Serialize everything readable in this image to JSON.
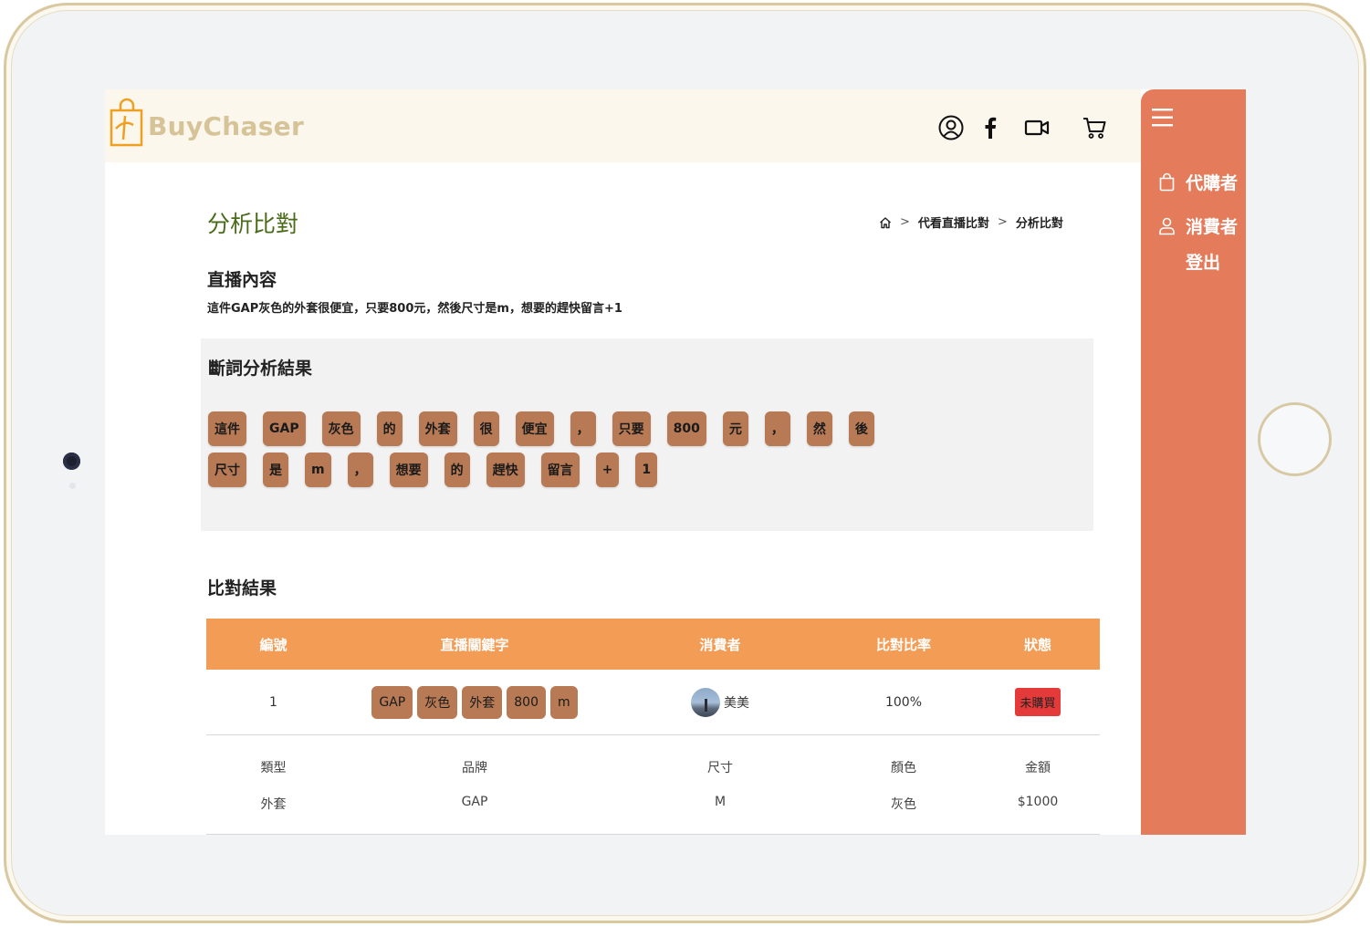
{
  "brand": {
    "name": "BuyChaser",
    "color": "#d6c398"
  },
  "header_icons": [
    "user-circle-icon",
    "facebook-icon",
    "video-icon",
    "cart-icon"
  ],
  "sidebar": {
    "menu_icon": "hamburger-icon",
    "items": [
      {
        "label": "代購者",
        "icon": "bag-icon"
      },
      {
        "label": "消費者",
        "icon": "user-icon"
      },
      {
        "label": "登出"
      }
    ]
  },
  "page": {
    "title": "分析比對"
  },
  "breadcrumb": {
    "home_icon": "home-icon",
    "sep": ">",
    "level1": "代看直播比對",
    "current": "分析比對"
  },
  "live": {
    "title": "直播內容",
    "text": "這件GAP灰色的外套很便宜，只要800元，然後尺寸是m，想要的趕快留言+1"
  },
  "segmentation": {
    "title": "斷詞分析結果",
    "row1": [
      "這件",
      "GAP",
      "灰色",
      "的",
      "外套",
      "很",
      "便宜",
      "，",
      "只要",
      "800",
      "元",
      "，",
      "然",
      "後"
    ],
    "row2": [
      "尺寸",
      "是",
      "m",
      "，",
      "想要",
      "的",
      "趕快",
      "留言",
      "+",
      "1"
    ]
  },
  "compare": {
    "title": "比對結果",
    "headers": [
      "編號",
      "直播關鍵字",
      "消費者",
      "比對比率",
      "狀態"
    ],
    "row": {
      "no": "1",
      "keywords": [
        "GAP",
        "灰色",
        "外套",
        "800",
        "m"
      ],
      "buyer": "美美",
      "ratio": "100%",
      "status": "未購買"
    },
    "detail_headers": [
      "類型",
      "品牌",
      "尺寸",
      "顏色",
      "金額"
    ],
    "detail_values": [
      "外套",
      "GAP",
      "M",
      "灰色",
      "$1000"
    ]
  },
  "colors": {
    "accent": "#e47c5b",
    "table_header": "#f39c55",
    "chip": "#b77a55",
    "title": "#4a6b1a",
    "badge": "#e53a3a"
  }
}
